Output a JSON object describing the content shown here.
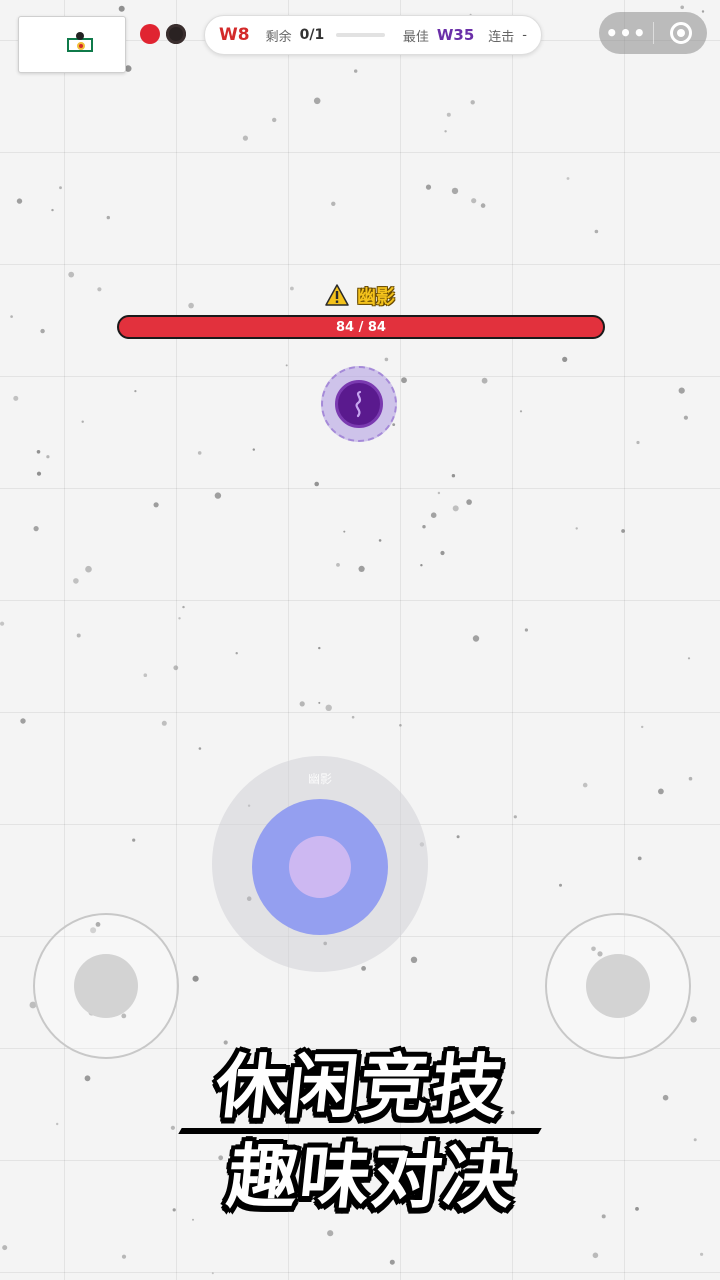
{
  "hud": {
    "wave": "W8",
    "remaining_label": "剩余",
    "remaining_value": "0/1",
    "wave_progress": 0,
    "best_label": "最佳",
    "best_value": "W35",
    "combo_label": "连击",
    "combo_value": "-"
  },
  "capsule": {
    "more_icon": "ellipsis-icon",
    "close_icon": "target-close-icon"
  },
  "boss": {
    "name": "幽影",
    "hp_current": 84,
    "hp_max": 84,
    "hp_text": "84 / 84",
    "icon": "warning-icon"
  },
  "player": {
    "name": "幽影"
  },
  "slogan": {
    "line1": "休闲竞技",
    "line2": "趣味对决"
  },
  "colors": {
    "accent_red": "#e2313d",
    "best_purple": "#6a2fa8",
    "boss_name_yellow": "#f3c21c",
    "player_blue": "#949ff0"
  }
}
